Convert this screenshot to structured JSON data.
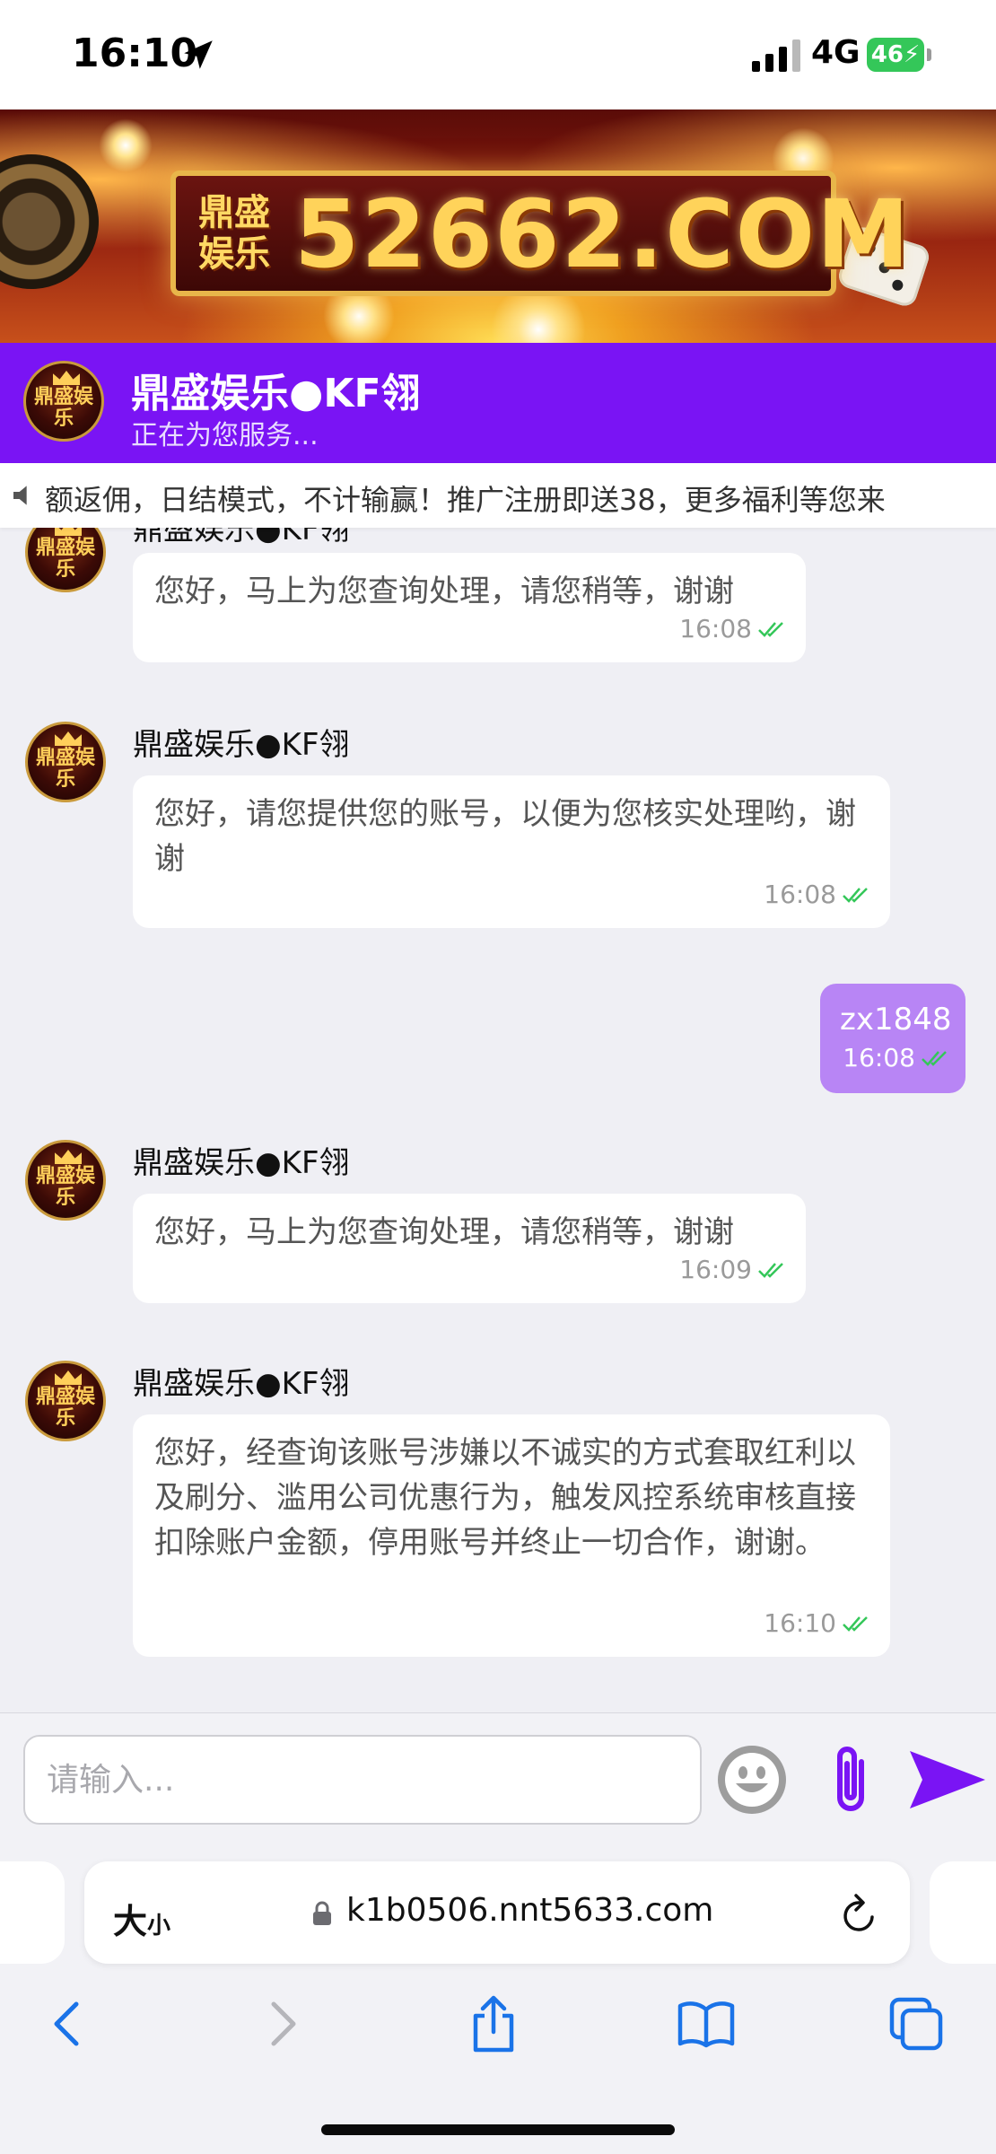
{
  "status_bar": {
    "time": "16:10",
    "network": "4G",
    "battery": "46"
  },
  "banner": {
    "logo_line1": "鼎盛",
    "logo_line2": "娱乐",
    "domain": "52662.COM"
  },
  "header": {
    "title": "鼎盛娱乐●KF翎",
    "status": "正在为您服务..."
  },
  "marquee": {
    "text": "额返佣，日结模式，不计输赢！推广注册即送38，更多福利等您来"
  },
  "messages": [
    {
      "side": "agent",
      "sender": "鼎盛娱乐●KF翎",
      "text": "您好，马上为您查询处理，请您稍等，谢谢",
      "time": "16:08"
    },
    {
      "side": "agent",
      "sender": "鼎盛娱乐●KF翎",
      "text": "您好，请您提供您的账号，以便为您核实处理哟，谢谢",
      "time": "16:08"
    },
    {
      "side": "user",
      "text": "zx1848",
      "time": "16:08"
    },
    {
      "side": "agent",
      "sender": "鼎盛娱乐●KF翎",
      "text": "您好，马上为您查询处理，请您稍等，谢谢",
      "time": "16:09"
    },
    {
      "side": "agent",
      "sender": "鼎盛娱乐●KF翎",
      "text": "您好，经查询该账号涉嫌以不诚实的方式套取红利以及刷分、滥用公司优惠行为，触发风控系统审核直接扣除账户金额，停用账号并终止一切合作，谢谢。",
      "time": "16:10"
    }
  ],
  "input": {
    "placeholder": "请输入..."
  },
  "browser": {
    "text_size_label": "大",
    "text_size_small": "小",
    "url": "k1b0506.nnt5633.com"
  },
  "colors": {
    "header_bg": "#7a14f4",
    "user_bubble": "#b885f5",
    "read_check": "#34c759",
    "accent": "#7a14f4"
  },
  "icons": [
    "location-arrow-icon",
    "signal-icon",
    "battery-icon",
    "speaker-icon",
    "emoji-icon",
    "paperclip-icon",
    "send-icon",
    "lock-icon",
    "reload-icon",
    "back-icon",
    "forward-icon",
    "share-icon",
    "bookmarks-icon",
    "tabs-icon"
  ]
}
